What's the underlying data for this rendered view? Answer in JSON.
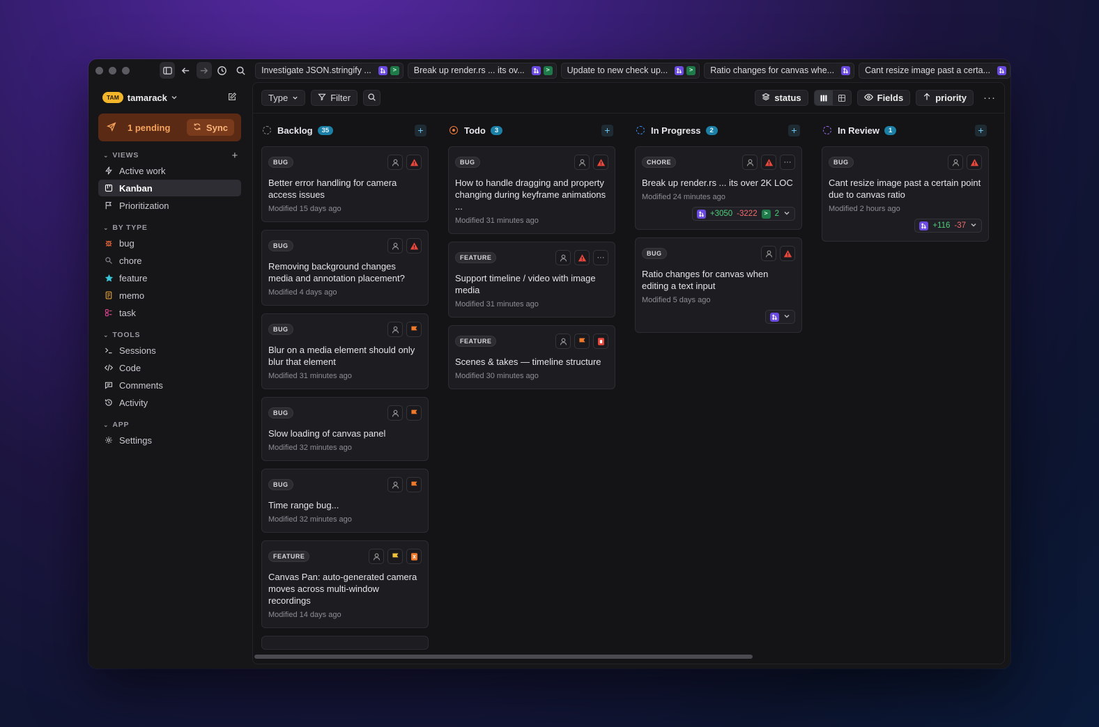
{
  "tabs": [
    {
      "title": "Investigate JSON.stringify ...",
      "gh": true,
      "term": true
    },
    {
      "title": "Break up render.rs ... its ov...",
      "gh": true,
      "term": true
    },
    {
      "title": "Update to new check up...",
      "gh": true,
      "term": true
    },
    {
      "title": "Ratio changes for canvas whe...",
      "gh": true,
      "term": false
    },
    {
      "title": "Cant resize image past a certa...",
      "gh": true,
      "term": false
    }
  ],
  "workspace": {
    "badge": "TAM",
    "name": "tamarack"
  },
  "pending": {
    "label": "1 pending",
    "sync_label": "Sync"
  },
  "sidebar": {
    "views_header": "VIEWS",
    "views": [
      {
        "label": "Active work",
        "icon": "bolt-icon",
        "selected": false
      },
      {
        "label": "Kanban",
        "icon": "kanban-icon",
        "selected": true
      },
      {
        "label": "Prioritization",
        "icon": "flag-icon",
        "selected": false
      }
    ],
    "type_header": "BY TYPE",
    "types": [
      {
        "label": "bug",
        "icon": "bug-icon",
        "color": "#e8663a"
      },
      {
        "label": "chore",
        "icon": "wrench-icon",
        "color": "#8c8c94"
      },
      {
        "label": "feature",
        "icon": "star-icon",
        "color": "#3ac4d8"
      },
      {
        "label": "memo",
        "icon": "memo-icon",
        "color": "#e0a23a"
      },
      {
        "label": "task",
        "icon": "task-icon",
        "color": "#d9458c"
      }
    ],
    "tools_header": "TOOLS",
    "tools": [
      {
        "label": "Sessions",
        "icon": "terminal-icon"
      },
      {
        "label": "Code",
        "icon": "code-icon"
      },
      {
        "label": "Comments",
        "icon": "comment-icon"
      },
      {
        "label": "Activity",
        "icon": "history-icon"
      }
    ],
    "app_header": "APP",
    "app": [
      {
        "label": "Settings",
        "icon": "gear-icon"
      }
    ]
  },
  "toolbar": {
    "type_label": "Type",
    "filter_label": "Filter",
    "status_label": "status",
    "fields_label": "Fields",
    "priority_label": "priority"
  },
  "columns": [
    {
      "title": "Backlog",
      "count": "35",
      "status_color": "#8a8a92",
      "cards": [
        {
          "type": "BUG",
          "title": "Better error handling for camera access issues",
          "modified": "Modified 15 days ago",
          "priority": "urgent"
        },
        {
          "type": "BUG",
          "title": "Removing background changes media and annotation placement?",
          "modified": "Modified 4 days ago",
          "priority": "urgent"
        },
        {
          "type": "BUG",
          "title": "Blur on a media element should only blur that element",
          "modified": "Modified 31 minutes ago",
          "priority": "high"
        },
        {
          "type": "BUG",
          "title": "Slow loading of canvas panel",
          "modified": "Modified 32 minutes ago",
          "priority": "high"
        },
        {
          "type": "BUG",
          "title": "Time range bug...",
          "modified": "Modified 32 minutes ago",
          "priority": "high"
        },
        {
          "type": "FEATURE",
          "title": "Canvas Pan: auto-generated camera moves across multi-window recordings",
          "modified": "Modified 14 days ago",
          "priority": "medium",
          "extra": "orange"
        }
      ]
    },
    {
      "title": "Todo",
      "count": "3",
      "status_color": "#f07a3a",
      "cards": [
        {
          "type": "BUG",
          "title": "How to handle dragging and property changing during keyframe animations ...",
          "modified": "Modified 31 minutes ago",
          "priority": "urgent"
        },
        {
          "type": "FEATURE",
          "title": "Support timeline / video with image media",
          "modified": "Modified 31 minutes ago",
          "priority": "urgent",
          "more": true
        },
        {
          "type": "FEATURE",
          "title": "Scenes & takes — timeline structure",
          "modified": "Modified 30 minutes ago",
          "priority": "high",
          "extra": "red"
        }
      ]
    },
    {
      "title": "In Progress",
      "count": "2",
      "status_color": "#3a8ef0",
      "cards": [
        {
          "type": "CHORE",
          "title": "Break up render.rs ... its over 2K LOC",
          "modified": "Modified 24 minutes ago",
          "priority": "urgent",
          "more": true,
          "pr": {
            "plus": "+3050",
            "minus": "-3222",
            "term_count": "2"
          }
        },
        {
          "type": "BUG",
          "title": "Ratio changes for canvas when editing a text input",
          "modified": "Modified 5 days ago",
          "priority": "urgent",
          "pr": {
            "plus": "",
            "minus": "",
            "term_count": ""
          }
        }
      ]
    },
    {
      "title": "In Review",
      "count": "1",
      "status_color": "#9a6af0",
      "cards": [
        {
          "type": "BUG",
          "title": "Cant resize image past a certain point due to canvas ratio",
          "modified": "Modified 2 hours ago",
          "priority": "urgent",
          "pr": {
            "plus": "+116",
            "minus": "-37",
            "term_count": ""
          }
        }
      ]
    }
  ],
  "colors": {
    "accent": "#1b7fa6",
    "pending_bg": "#5a2a15",
    "urgent": "#e8473a",
    "high": "#f07a2a",
    "medium": "#f0c13a"
  }
}
